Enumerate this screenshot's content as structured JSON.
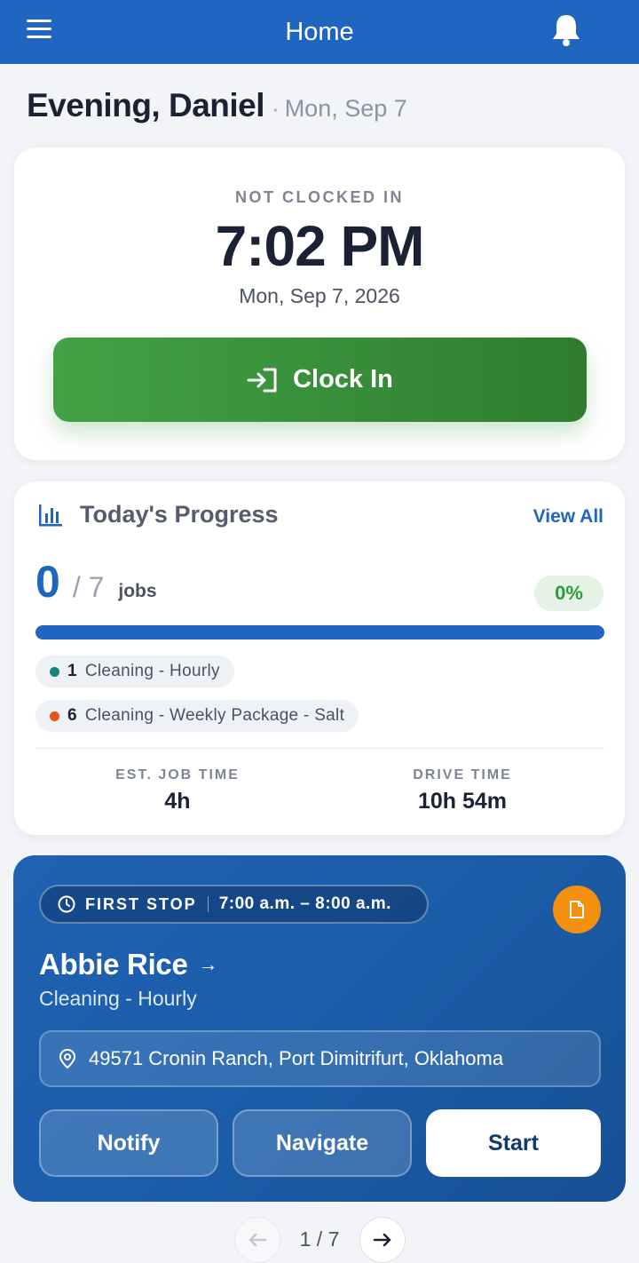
{
  "header": {
    "title": "Home"
  },
  "greeting": {
    "name": "Evening, Daniel",
    "separator": "·",
    "date": "Mon, Sep 7"
  },
  "clock": {
    "status": "NOT CLOCKED IN",
    "time": "7:02 PM",
    "full_date": "Mon, Sep 7, 2026",
    "button_label": "Clock In",
    "button_color": "#3b9a3d"
  },
  "progress": {
    "title": "Today's Progress",
    "view_all": "View All",
    "completed": "0",
    "total": "/ 7",
    "unit": "jobs",
    "percent_label": "0%",
    "percent_value": 0,
    "bar_color": "#1f66c1",
    "categories": [
      {
        "count": "1",
        "label": "Cleaning - Hourly",
        "color": "#13857f"
      },
      {
        "count": "6",
        "label": "Cleaning - Weekly Package - Salt",
        "color": "#e8541c"
      }
    ],
    "stats": [
      {
        "label": "EST. JOB TIME",
        "value": "4h"
      },
      {
        "label": "DRIVE TIME",
        "value": "10h 54m"
      }
    ]
  },
  "job": {
    "stop_label": "FIRST STOP",
    "time_window": "7:00 a.m. – 8:00 a.m.",
    "client": "Abbie Rice",
    "client_arrow": "→",
    "service": "Cleaning - Hourly",
    "address": "49571 Cronin Ranch, Port Dimitrifurt, Oklahoma",
    "buttons": {
      "notify": "Notify",
      "navigate": "Navigate",
      "start": "Start"
    },
    "card_color": "#1f62b2",
    "badge_color": "#f5900f"
  },
  "pager": {
    "label": "1 / 7",
    "current": 1,
    "total": 7
  },
  "icons": {
    "menu": "menu-icon",
    "bell": "bell-icon",
    "clock_in": "sign-in-icon",
    "chart": "bar-chart-icon",
    "clock_pin": "clock-pin-icon",
    "document": "document-icon",
    "location": "location-pin-icon",
    "prev": "arrow-left-icon",
    "next": "arrow-right-icon"
  }
}
